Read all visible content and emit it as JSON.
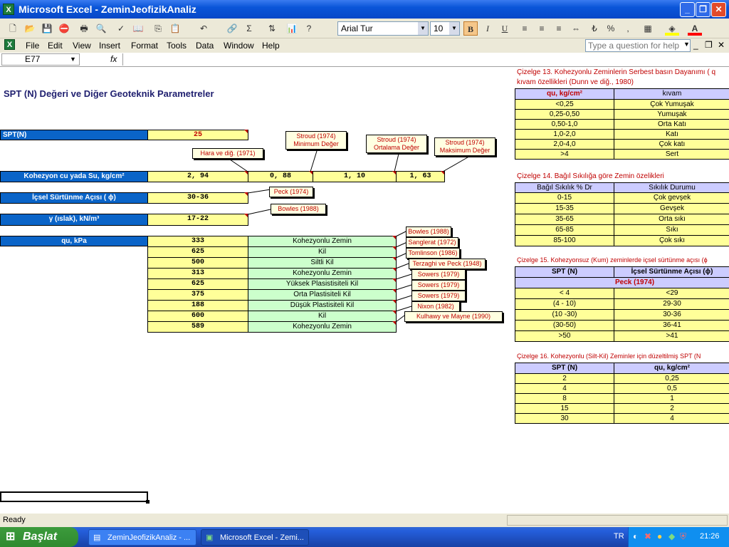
{
  "window": {
    "title": "Microsoft Excel - ZeminJeofizikAnaliz"
  },
  "toolbar": {
    "font": "Arial Tur",
    "size": "10",
    "bold": "B",
    "italic": "I",
    "underline": "U",
    "percent": "%"
  },
  "menu": [
    "File",
    "Edit",
    "View",
    "Insert",
    "Format",
    "Tools",
    "Data",
    "Window",
    "Help"
  ],
  "help_placeholder": "Type a question for help",
  "namebox": "E77",
  "fx": "fx",
  "sheet": {
    "title": "SPT (N) Değeri ve Diğer Geoteknik Parametreler",
    "spt_label": "SPT(N)",
    "spt_value": "25",
    "cu_label": "Kohezyon cu yada Su, kg/cm²",
    "cu_values": [
      "2, 94",
      "0, 88",
      "1, 10",
      "1, 63"
    ],
    "phi_label": "İçsel Sürtünme Açısı ( ϕ)",
    "phi_value": "30-36",
    "gamma_label": "γ (ıslak), kN/m³",
    "gamma_value": "17-22",
    "qu_label": "qu, kPa",
    "qu_rows": [
      {
        "v": "333",
        "s": "Kohezyonlu Zemin"
      },
      {
        "v": "625",
        "s": "Kil"
      },
      {
        "v": "500",
        "s": "Siltli Kil"
      },
      {
        "v": "313",
        "s": "Kohezyonlu Zemin"
      },
      {
        "v": "625",
        "s": "Yüksek Plasistisiteli Kil"
      },
      {
        "v": "375",
        "s": "Orta Plastisiteli Kil"
      },
      {
        "v": "188",
        "s": "Düşük Plastisiteli Kil"
      },
      {
        "v": "600",
        "s": "Kil"
      },
      {
        "v": "589",
        "s": "Kohezyonlu Zemin"
      }
    ],
    "notes": {
      "hara": "Hara ve diğ. (1971)",
      "stroud_min": "Stroud (1974) Minimum Değer",
      "stroud_ort": "Stroud (1974) Ortalama Değer",
      "stroud_max": "Stroud (1974) Maksimum Değer",
      "peck": "Peck (1974)",
      "bowles": "Bowles (1988)",
      "qu": [
        "Bowles (1988)",
        "Sanglerat (1972)",
        "Tomlinson (1986)",
        "Terzaghi ve Peck (1948)",
        "Sowers (1979)",
        "Sowers (1979)",
        "Sowers (1979)",
        "Nixon (1982)",
        "Kulhawy ve Mayne (1990)"
      ]
    }
  },
  "tables": {
    "t13": {
      "cap1": "Çizelge 13. Kohezyonlu Zeminlerin Serbest basın Dayanımı ( q",
      "cap2": "kıvam özellikleri (Dunn ve diğ., 1980)",
      "h1": "qu, kg/cm²",
      "h2": "kıvam",
      "rows": [
        [
          "<0,25",
          "Çok Yumuşak"
        ],
        [
          "0,25-0,50",
          "Yumuşak"
        ],
        [
          "0,50-1,0",
          "Orta Katı"
        ],
        [
          "1,0-2,0",
          "Katı"
        ],
        [
          "2,0-4,0",
          "Çok katı"
        ],
        [
          ">4",
          "Sert"
        ]
      ]
    },
    "t14": {
      "cap": "Çizelge 14. Bağıl Sıkılığa göre Zemin özelikleri",
      "h1": "Bağıl Sıkılık % Dr",
      "h2": "Sıkılık Durumu",
      "rows": [
        [
          "0-15",
          "Çok gevşek"
        ],
        [
          "15-35",
          "Gevşek"
        ],
        [
          "35-65",
          "Orta sıkı"
        ],
        [
          "65-85",
          "Sıkı"
        ],
        [
          "85-100",
          "Çok sıkı"
        ]
      ]
    },
    "t15": {
      "cap": "Çizelge 15. Kohezyonsuz (Kum) zeminlerde içsel sürtünme açısı (ϕ",
      "h1": "SPT (N)",
      "h2": "İçsel Sürtünme Açısı (ϕ)",
      "sub": "Peck (1974)",
      "rows": [
        [
          "< 4",
          "<29"
        ],
        [
          "(4 - 10)",
          "29-30"
        ],
        [
          "(10 -30)",
          "30-36"
        ],
        [
          "(30-50)",
          "36-41"
        ],
        [
          ">50",
          ">41"
        ]
      ]
    },
    "t16": {
      "cap": "Çizelge 16. Kohezyonlu (Silt-Kil) Zeminler için düzeltilmiş SPT (N",
      "h1": "SPT (N)",
      "h2": "qu, kg/cm²",
      "rows": [
        [
          "2",
          "0,25"
        ],
        [
          "4",
          "0,5"
        ],
        [
          "8",
          "1"
        ],
        [
          "15",
          "2"
        ],
        [
          "30",
          "4"
        ]
      ]
    }
  },
  "status": "Ready",
  "taskbar": {
    "start": "Başlat",
    "t1": "ZeminJeofizikAnaliz - ...",
    "t2": "Microsoft Excel - Zemi...",
    "lang": "TR",
    "clock": "21:26"
  }
}
